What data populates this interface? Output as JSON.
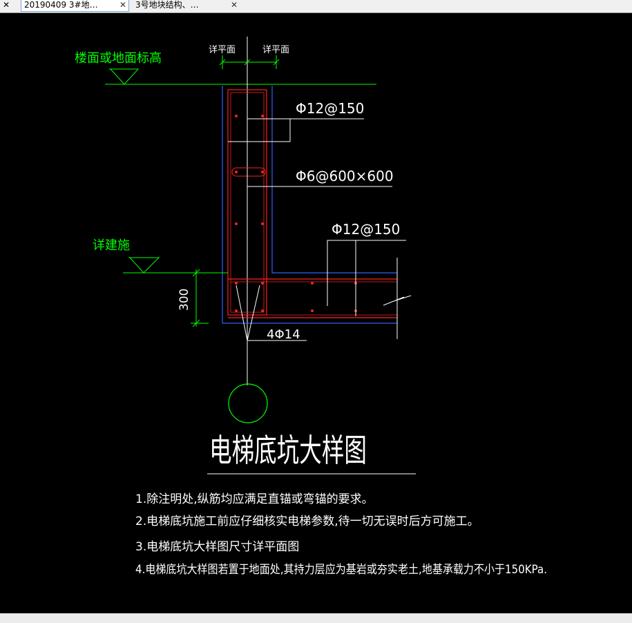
{
  "tabs": [
    {
      "label": "20190409 3#地…",
      "close": "✕",
      "active": true
    },
    {
      "label": "3号地块结构、…",
      "close": "✕",
      "active": false
    }
  ],
  "left_close": "✕",
  "drawing": {
    "title": "电梯底坑大样图",
    "floor_level_label": "楼面或地面标高",
    "detail_arch_label": "详建施",
    "detail_plan_left": "详平面",
    "detail_plan_right": "详平面",
    "rebar_top": "Φ12@150",
    "rebar_tie": "Φ6@600×600",
    "rebar_slab": "Φ12@150",
    "rebar_corner": "4Φ14",
    "dim_300": "300",
    "notes": [
      "1.除注明处,纵筋均应满足直锚或弯锚的要求。",
      "2.电梯底坑施工前应仔细核实电梯参数,待一切无误时后方可施工。",
      "3.电梯底坑大样图尺寸详平面图",
      "4.电梯底坑大样图若置于地面处,其持力层应为基岩或夯实老土,地基承载力不小于150KPa."
    ]
  },
  "colors": {
    "green": "#00ff00",
    "white": "#ffffff",
    "red": "#ff2020",
    "blue": "#3060ff",
    "background": "#000000"
  }
}
